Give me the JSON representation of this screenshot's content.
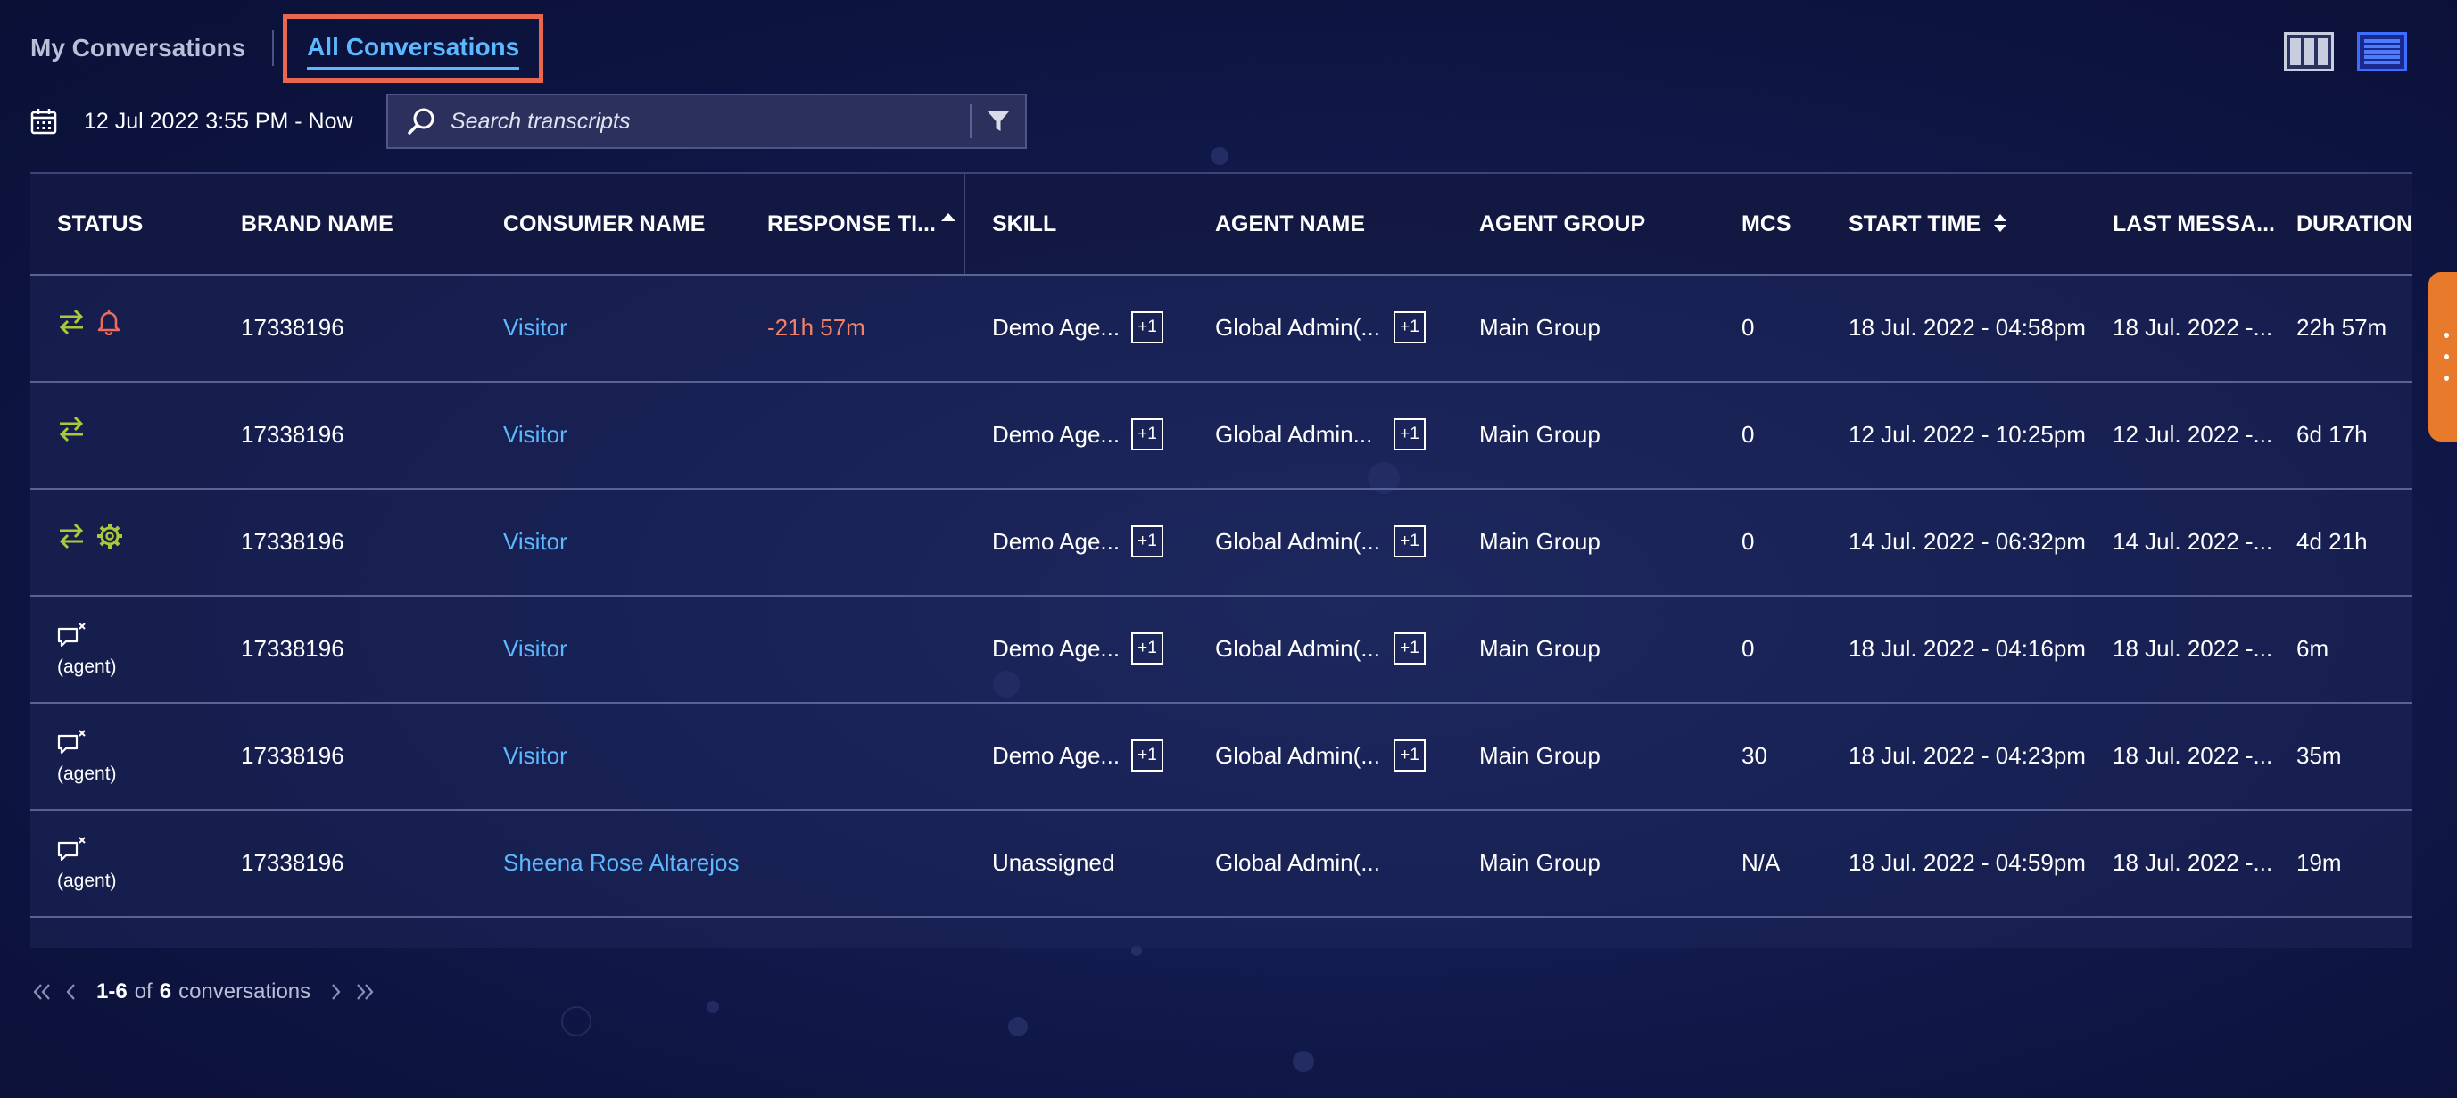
{
  "tabs": {
    "my": "My Conversations",
    "all": "All Conversations"
  },
  "view_icons": [
    "columns-view-icon",
    "list-view-icon"
  ],
  "date_range": "12 Jul 2022 3:55 PM - Now",
  "search": {
    "placeholder": "Search transcripts",
    "value": ""
  },
  "table": {
    "headers": {
      "status": "STATUS",
      "brand": "BRAND NAME",
      "consumer": "CONSUMER NAME",
      "response": "RESPONSE TI...",
      "skill": "SKILL",
      "agent": "AGENT NAME",
      "group": "AGENT GROUP",
      "mcs": "MCS",
      "start": "START TIME",
      "last": "LAST MESSA...",
      "duration": "DURATION"
    },
    "rows": [
      {
        "status_icons": [
          "transfer-icon",
          "bell-icon"
        ],
        "status_label": "",
        "brand": "17338196",
        "consumer": "Visitor",
        "response": "-21h 57m",
        "skill": "Demo Age...",
        "skill_extra": "+1",
        "agent": "Global Admin(...",
        "agent_extra": "+1",
        "group": "Main Group",
        "mcs": "0",
        "start": "18 Jul. 2022 - 04:58pm",
        "last": "18 Jul. 2022 -...",
        "duration": "22h 57m"
      },
      {
        "status_icons": [
          "transfer-icon"
        ],
        "status_label": "",
        "brand": "17338196",
        "consumer": "Visitor",
        "response": "",
        "skill": "Demo Age...",
        "skill_extra": "+1",
        "agent": "Global Admin...",
        "agent_extra": "+1",
        "group": "Main Group",
        "mcs": "0",
        "start": "12 Jul. 2022 - 10:25pm",
        "last": "12 Jul. 2022 -...",
        "duration": "6d 17h"
      },
      {
        "status_icons": [
          "transfer-icon",
          "gear-icon"
        ],
        "status_label": "",
        "brand": "17338196",
        "consumer": "Visitor",
        "response": "",
        "skill": "Demo Age...",
        "skill_extra": "+1",
        "agent": "Global Admin(...",
        "agent_extra": "+1",
        "group": "Main Group",
        "mcs": "0",
        "start": "14 Jul. 2022 - 06:32pm",
        "last": "14 Jul. 2022 -...",
        "duration": "4d 21h"
      },
      {
        "status_icons": [
          "closed-chat-icon"
        ],
        "status_label": "(agent)",
        "brand": "17338196",
        "consumer": "Visitor",
        "response": "",
        "skill": "Demo Age...",
        "skill_extra": "+1",
        "agent": "Global Admin(...",
        "agent_extra": "+1",
        "group": "Main Group",
        "mcs": "0",
        "start": "18 Jul. 2022 - 04:16pm",
        "last": "18 Jul. 2022 -...",
        "duration": "6m"
      },
      {
        "status_icons": [
          "closed-chat-icon"
        ],
        "status_label": "(agent)",
        "brand": "17338196",
        "consumer": "Visitor",
        "response": "",
        "skill": "Demo Age...",
        "skill_extra": "+1",
        "agent": "Global Admin(...",
        "agent_extra": "+1",
        "group": "Main Group",
        "mcs": "30",
        "start": "18 Jul. 2022 - 04:23pm",
        "last": "18 Jul. 2022 -...",
        "duration": "35m"
      },
      {
        "status_icons": [
          "closed-chat-icon"
        ],
        "status_label": "(agent)",
        "brand": "17338196",
        "consumer": "Sheena Rose Altarejos",
        "response": "",
        "skill": "Unassigned",
        "skill_extra": "",
        "agent": "Global Admin(...",
        "agent_extra": "",
        "group": "Main Group",
        "mcs": "N/A",
        "start": "18 Jul. 2022 - 04:59pm",
        "last": "18 Jul. 2022 -...",
        "duration": "19m"
      }
    ]
  },
  "pagination": {
    "range": "1-6",
    "of": "of",
    "total": "6",
    "suffix": "conversations"
  },
  "colors": {
    "accent": "#5cb8ff",
    "highlight_border": "#e8674f",
    "negative": "#f0826c",
    "status_green": "#a9c93a",
    "alert_red": "#f06a5a",
    "side_handle": "#e87a2c"
  }
}
